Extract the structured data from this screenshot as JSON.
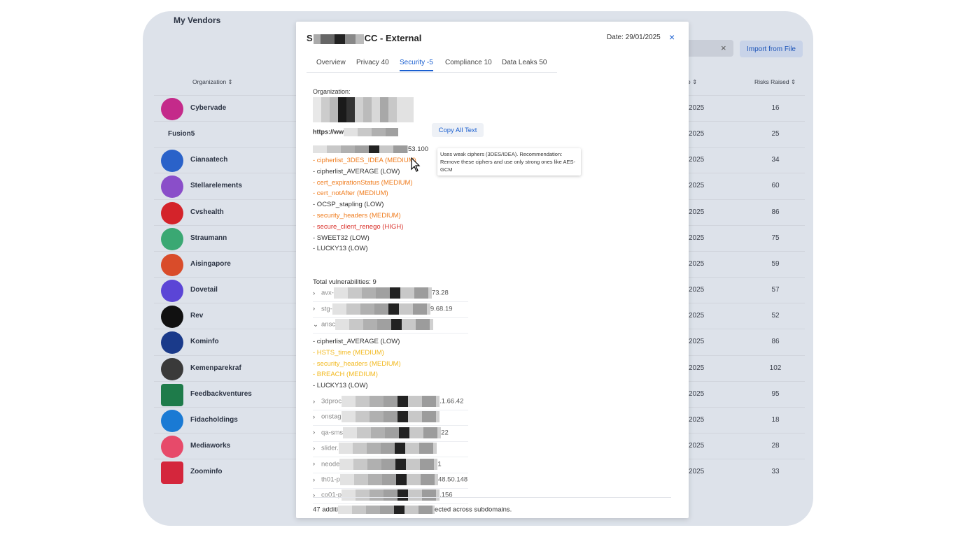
{
  "background": {
    "page_title": "My Vendors",
    "search_clear": "×",
    "import_button": "Import from File",
    "columns": {
      "organization": "Organization ⇕",
      "date": "e ⇕",
      "risks": "Risks Raised ⇕"
    },
    "vendors": [
      {
        "name": "Cybervade",
        "date": "2025",
        "risks": "16",
        "color": "#c42a8a"
      },
      {
        "name": "Fusion5",
        "date": "2025",
        "risks": "25",
        "color": ""
      },
      {
        "name": "Cianaatech",
        "date": "2025",
        "risks": "34",
        "color": "#2a62c9"
      },
      {
        "name": "Stellarelements",
        "date": "2025",
        "risks": "60",
        "color": "#8a4ec9"
      },
      {
        "name": "Cvshealth",
        "date": "2025",
        "risks": "86",
        "color": "#d4232a"
      },
      {
        "name": "Straumann",
        "date": "2025",
        "risks": "75",
        "color": "#3aa873"
      },
      {
        "name": "Aisingapore",
        "date": "2025",
        "risks": "59",
        "color": "#d94c2a"
      },
      {
        "name": "Dovetail",
        "date": "2025",
        "risks": "57",
        "color": "#5b45d6"
      },
      {
        "name": "Rev",
        "date": "2025",
        "risks": "52",
        "color": "#111111"
      },
      {
        "name": "Kominfo",
        "date": "2025",
        "risks": "86",
        "color": "#1a3a8a"
      },
      {
        "name": "Kemenparekraf",
        "date": "2025",
        "risks": "102",
        "color": "#3a3a3a"
      },
      {
        "name": "Feedbackventures",
        "date": "2025",
        "risks": "95",
        "color": "#1e7b4a"
      },
      {
        "name": "Fidacholdings",
        "date": "2025",
        "risks": "18",
        "color": "#1a7ad4"
      },
      {
        "name": "Mediaworks",
        "date": "2025",
        "risks": "28",
        "color": "#e74a6a"
      },
      {
        "name": "Zoominfo",
        "date": "2025",
        "risks": "33",
        "color": "#d4263c"
      }
    ]
  },
  "modal": {
    "title_prefix": "S",
    "title_suffix": "CC - External",
    "date": "Date: 29/01/2025",
    "close": "×",
    "tabs": [
      "Overview",
      "Privacy 40",
      "Security -5",
      "Compliance 10",
      "Data Leaks 50"
    ],
    "active_tab": 2,
    "org_label": "Organization:",
    "url_prefix": "https://ww",
    "copy_button": "Copy All Text",
    "host1_suffix": "53.100",
    "tooltip": "Uses weak ciphers (3DES/IDEA). Recommendation: Remove these ciphers and use only strong ones like AES-GCM",
    "host1_findings": [
      {
        "text": "- cipherlist_3DES_IDEA (MEDIUM)",
        "sev": "med"
      },
      {
        "text": "- cipherlist_AVERAGE (LOW)",
        "sev": "low"
      },
      {
        "text": "- cert_expirationStatus (MEDIUM)",
        "sev": "med"
      },
      {
        "text": "- cert_notAfter (MEDIUM)",
        "sev": "med"
      },
      {
        "text": "- OCSP_stapling (LOW)",
        "sev": "low"
      },
      {
        "text": "- security_headers (MEDIUM)",
        "sev": "med"
      },
      {
        "text": "- secure_client_renego (HIGH)",
        "sev": "high"
      },
      {
        "text": "- SWEET32 (LOW)",
        "sev": "low"
      },
      {
        "text": "- LUCKY13 (LOW)",
        "sev": "low"
      }
    ],
    "total": "Total vulnerabilities: 9",
    "collapsed_a": [
      {
        "chev": "›",
        "prefix": "avx-",
        "suffix": "73.28"
      },
      {
        "chev": "›",
        "prefix": "stg-",
        "suffix": "9.68.19"
      },
      {
        "chev": "⌄",
        "prefix": "ansc",
        "suffix": ""
      }
    ],
    "host2_findings": [
      {
        "text": "- cipherlist_AVERAGE (LOW)",
        "sev": "low"
      },
      {
        "text": "- HSTS_time (MEDIUM)",
        "sev": "yel"
      },
      {
        "text": "- security_headers (MEDIUM)",
        "sev": "yel"
      },
      {
        "text": "- BREACH (MEDIUM)",
        "sev": "yel"
      },
      {
        "text": "- LUCKY13 (LOW)",
        "sev": "low"
      }
    ],
    "collapsed_b": [
      {
        "chev": "›",
        "prefix": "3dproc",
        "suffix": ".1.66.42"
      },
      {
        "chev": "›",
        "prefix": "onstag",
        "suffix": ""
      },
      {
        "chev": "›",
        "prefix": "qa-sms",
        "suffix": "22"
      },
      {
        "chev": "›",
        "prefix": "slider.",
        "suffix": ""
      },
      {
        "chev": "›",
        "prefix": "neode",
        "suffix": "1"
      },
      {
        "chev": "›",
        "prefix": "th01-p",
        "suffix": "48.50.148"
      },
      {
        "chev": "›",
        "prefix": "co01-p",
        "suffix": ".156"
      }
    ],
    "footer_prefix": "47 additi",
    "footer_suffix": "ected across subdomains."
  }
}
